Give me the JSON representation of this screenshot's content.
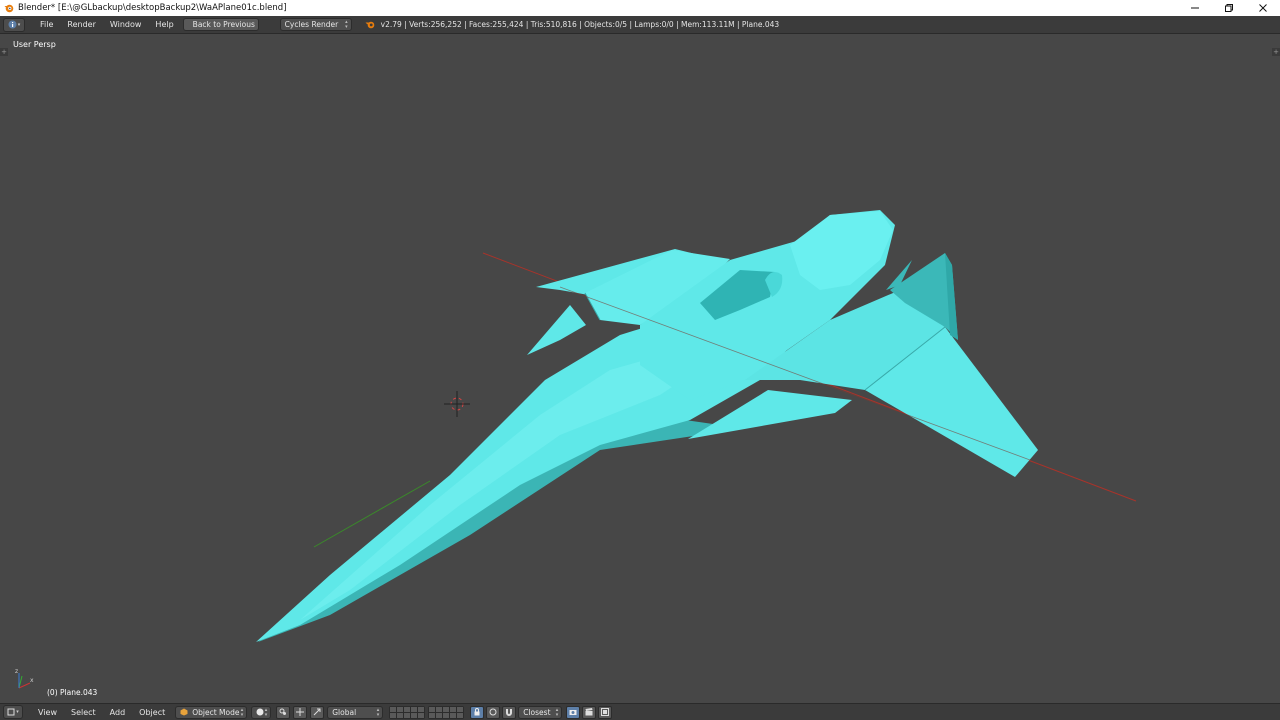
{
  "window": {
    "title": "Blender* [E:\\@GLbackup\\desktopBackup2\\WaAPlane01c.blend]"
  },
  "info_header": {
    "menus": [
      "File",
      "Render",
      "Window",
      "Help"
    ],
    "back_button": "Back to Previous",
    "render_engine": "Cycles Render",
    "stats": "v2.79 | Verts:256,252 | Faces:255,424 | Tris:510,816 | Objects:0/5 | Lamps:0/0 | Mem:113.11M | Plane.043"
  },
  "viewport": {
    "view_name": "User Persp",
    "object_info": "(0) Plane.043",
    "model_color": "#5fe8e8"
  },
  "view3d_header": {
    "menus": [
      "View",
      "Select",
      "Add",
      "Object"
    ],
    "mode": "Object Mode",
    "orientation": "Global",
    "snap_target": "Closest"
  },
  "colors": {
    "viewport_bg": "#474747",
    "header_bg": "#3b3b3b",
    "x_axis": "#c0392b",
    "y_axis": "#3a8a2a",
    "accent_active": "#5d7fa8"
  }
}
